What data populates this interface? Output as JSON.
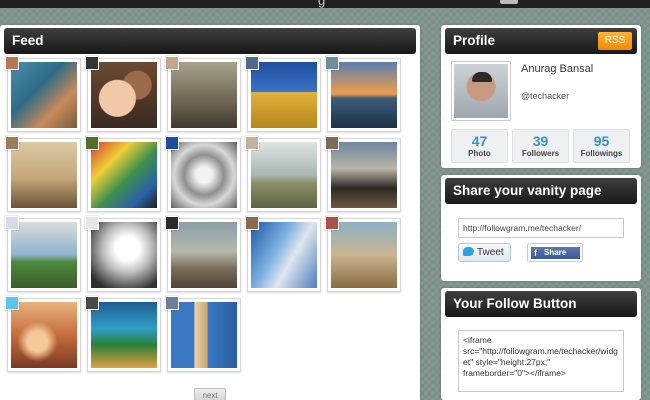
{
  "topbar": {
    "title_glyph": "g"
  },
  "feed": {
    "title": "Feed",
    "next_label": "next",
    "photos": [
      {
        "bg": "linear-gradient(135deg,#4b8fae 0%,#2e6a85 40%,#c98a5a 70%,#7a5a3a 100%)",
        "avatar": "#b57a55"
      },
      {
        "bg": "radial-gradient(circle at 40% 55%,#f1c9a9 0 18px,transparent 19px),radial-gradient(circle at 70% 35%,#9a6a4b 0 14px,transparent 15px),linear-gradient(#6b4a32,#3a2a20)",
        "avatar": "#333333"
      },
      {
        "bg": "linear-gradient(#a7a38a,#6e6552 60%,#3f3a2e)",
        "avatar": "#c6a58a"
      },
      {
        "bg": "linear-gradient(#1f4f9c 0%,#3b72c4 45%,#e0b23b 46%,#b5861c 100%)",
        "avatar": "#4e6b8a"
      },
      {
        "bg": "linear-gradient(#5a7fb0 0%,#ee9d4b 48%,#3c5d7a 55%,#1d3147 100%)",
        "avatar": "#6b8f9a"
      },
      {
        "bg": "linear-gradient(#dcc9a4 0%,#c3a77a 55%,#6b5236 100%)",
        "avatar": "#9b7b5a"
      },
      {
        "bg": "linear-gradient(135deg,#d63a2f 0%,#efcf3a 30%,#3f8f4c 55%,#2a61a8 80%,#1f1f1f 100%)",
        "avatar": "#556b2f"
      },
      {
        "bg": "radial-gradient(circle at 50% 50%,#f2f2f2 0 8px,#8f8f8f 20px,#d8d8d8 30px,#555 48px)",
        "avatar": "#1f4b99"
      },
      {
        "bg": "linear-gradient(#dde4e2 0%,#aab7b5 50%,#8c8f6a 62%,#5d6442 100%)",
        "avatar": "#c1b39a"
      },
      {
        "bg": "linear-gradient(#6d85a0 0%,#b9b5a7 40%,#2c2a26 70%,#6b5a40 100%)",
        "avatar": "#7a6b5a"
      },
      {
        "bg": "linear-gradient(#d9ddd9 0%,#8fb3cf 50%,#4f8a3e 60%,#3a5a2a 100%)",
        "avatar": "#d8dce8"
      },
      {
        "bg": "radial-gradient(circle at 55% 40%,#ffffff 0 12px,#bfbfbf 24px,#2e2e2e 45px)",
        "avatar": "#e6e6e6"
      },
      {
        "bg": "linear-gradient(#8a9ea8 0%,#b4b9ab 45%,#7a6e5a 70%,#4f4536 100%)",
        "avatar": "#2a2a2a"
      },
      {
        "bg": "linear-gradient(120deg,#1c5aa8 0%,#7fb1e0 40%,#e0e6ee 60%,#4d7cc0 100%)",
        "avatar": "#8c6a4f"
      },
      {
        "bg": "linear-gradient(#8db2c4 0%,#c9b490 50%,#8a6b3f 100%)",
        "avatar": "#a6544b"
      },
      {
        "bg": "radial-gradient(circle at 40% 60%,#f5c99a 0 10px,transparent 20px),linear-gradient(#e7b27e 0%,#c56d3d 50%,#7a3a22 100%)",
        "avatar": "#5ec4e8"
      },
      {
        "bg": "linear-gradient(#1e5d8f 0%,#2f9ec9 40%,#2c7f3a 65%,#e0a040 100%)",
        "avatar": "#4a4a4a"
      },
      {
        "bg": "linear-gradient(90deg,#3a78c4 0%,#3a78c4 35%,#e8d5a9 36%,#c9a76f 55%,#3a78c4 56%,#2b5f9e 100%)",
        "avatar": "#6a7fa0"
      }
    ]
  },
  "profile": {
    "title": "Profile",
    "rss_label": "RSS",
    "name": "Anurag Bansal",
    "handle": "@techacker",
    "stats": [
      {
        "num": "47",
        "label": "Photo"
      },
      {
        "num": "39",
        "label": "Followers"
      },
      {
        "num": "95",
        "label": "Followings"
      }
    ]
  },
  "vanity": {
    "title": "Share your vanity page",
    "url": "http://followgram.me/techacker/",
    "tweet_label": "Tweet",
    "share_label": "Share"
  },
  "follow_button": {
    "title": "Your Follow Button",
    "embed_code": "<iframe\nsrc=\"http://followgram.me/techacker/widget\" style=\"height:27px;\"\nframeborder=\"0\"></iframe>"
  }
}
